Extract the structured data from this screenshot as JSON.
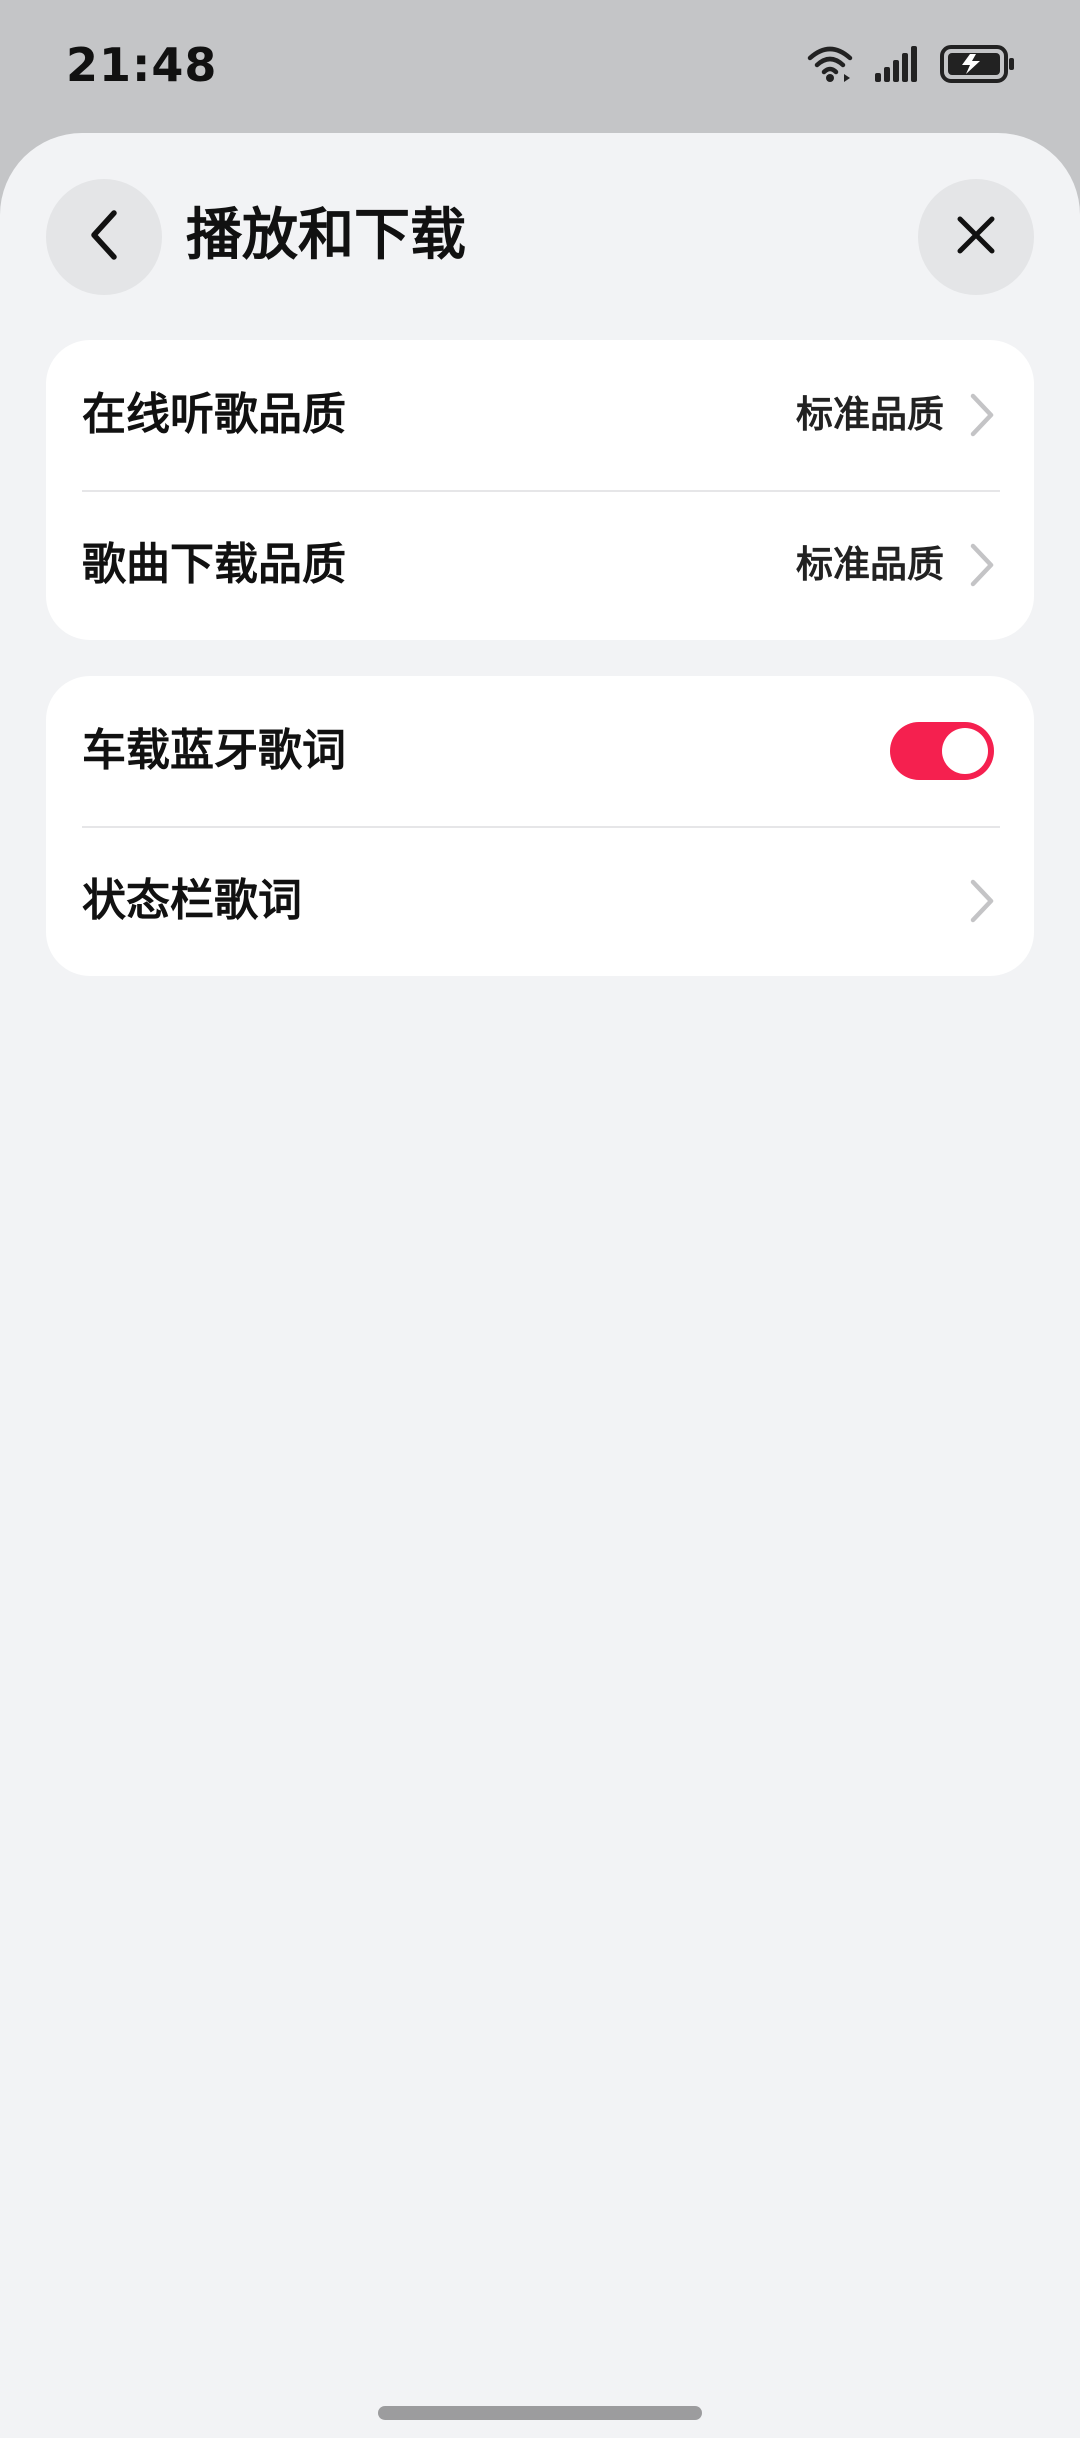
{
  "status_bar": {
    "time": "21:48",
    "icons": [
      "wifi-icon",
      "signal-icon",
      "battery-charging-icon"
    ]
  },
  "header": {
    "title": "播放和下载",
    "back_icon": "chevron-left-icon",
    "close_icon": "close-icon"
  },
  "quality_group": {
    "items": [
      {
        "label": "在线听歌品质",
        "value": "标准品质"
      },
      {
        "label": "歌曲下载品质",
        "value": "标准品质"
      }
    ]
  },
  "lyrics_group": {
    "items": [
      {
        "label": "车载蓝牙歌词",
        "toggle_on": true
      },
      {
        "label": "状态栏歌词"
      }
    ]
  },
  "colors": {
    "accent": "#f5204f",
    "sheet_background": "#f2f3f5",
    "backdrop": "#c4c5c7",
    "card": "#ffffff"
  }
}
